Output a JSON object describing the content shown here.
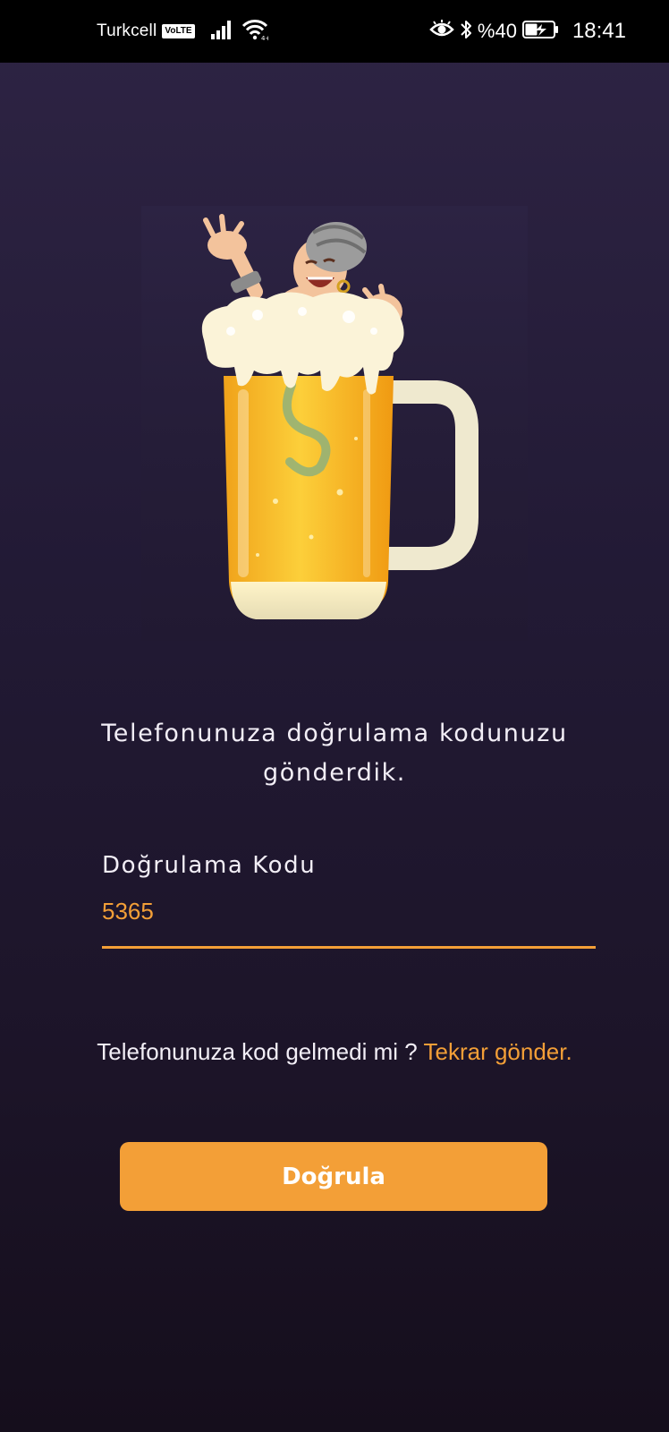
{
  "status_bar": {
    "carrier": "Turkcell",
    "volte_badge": "VoLTE",
    "battery_percent": "%40",
    "time": "18:41",
    "icons": [
      "signal-icon",
      "wifi-icon",
      "eye-comfort-icon",
      "bluetooth-icon",
      "battery-charging-icon"
    ]
  },
  "illustration": {
    "name": "beer-mug-mascot"
  },
  "message": "Telefonunuza doğrulama kodunuzu gönderdik.",
  "code_field": {
    "label": "Doğrulama Kodu",
    "value": "5365"
  },
  "resend": {
    "prompt": "Telefonunuza kod gelmedi mi ? ",
    "link": "Tekrar gönder."
  },
  "verify_button": {
    "label": "Doğrula"
  },
  "colors": {
    "accent": "#f39f37",
    "background_top": "#2e2444",
    "background_bottom": "#150e1c",
    "text": "#f2eef6"
  }
}
